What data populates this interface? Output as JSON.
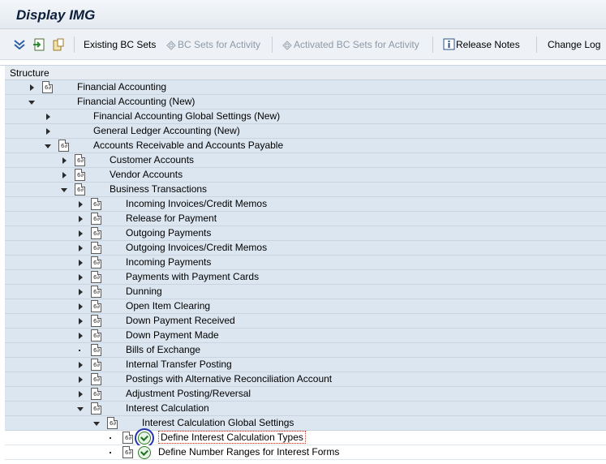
{
  "window": {
    "title": "Display IMG"
  },
  "toolbar": {
    "existing_bc_sets": "Existing BC Sets",
    "bc_sets_for_activity": "BC Sets for Activity",
    "activated_bc_sets": "Activated BC Sets for Activity",
    "release_notes": "Release Notes",
    "change_log": "Change Log"
  },
  "tree": {
    "header": "Structure",
    "rows": [
      {
        "label": "Financial Accounting",
        "expander": "right",
        "doc": true
      },
      {
        "label": "Financial Accounting (New)",
        "expander": "down",
        "doc": false
      },
      {
        "label": "Financial Accounting Global Settings (New)",
        "expander": "right",
        "doc": false
      },
      {
        "label": "General Ledger Accounting (New)",
        "expander": "right",
        "doc": false
      },
      {
        "label": "Accounts Receivable and Accounts Payable",
        "expander": "down",
        "doc": true
      },
      {
        "label": "Customer Accounts",
        "expander": "right",
        "doc": true
      },
      {
        "label": "Vendor Accounts",
        "expander": "right",
        "doc": true
      },
      {
        "label": "Business Transactions",
        "expander": "down",
        "doc": true
      },
      {
        "label": "Incoming Invoices/Credit Memos",
        "expander": "right",
        "doc": true
      },
      {
        "label": "Release for Payment",
        "expander": "right",
        "doc": true
      },
      {
        "label": "Outgoing Payments",
        "expander": "right",
        "doc": true
      },
      {
        "label": "Outgoing Invoices/Credit Memos",
        "expander": "right",
        "doc": true
      },
      {
        "label": "Incoming Payments",
        "expander": "right",
        "doc": true
      },
      {
        "label": "Payments with Payment Cards",
        "expander": "right",
        "doc": true
      },
      {
        "label": "Dunning",
        "expander": "right",
        "doc": true
      },
      {
        "label": "Open Item Clearing",
        "expander": "right",
        "doc": true
      },
      {
        "label": "Down Payment Received",
        "expander": "right",
        "doc": true
      },
      {
        "label": "Down Payment Made",
        "expander": "right",
        "doc": true
      },
      {
        "label": "Bills of Exchange",
        "expander": "dot",
        "doc": true
      },
      {
        "label": "Internal Transfer Posting",
        "expander": "right",
        "doc": true
      },
      {
        "label": "Postings with Alternative Reconciliation Account",
        "expander": "right",
        "doc": true
      },
      {
        "label": "Adjustment Posting/Reversal",
        "expander": "right",
        "doc": true
      },
      {
        "label": "Interest Calculation",
        "expander": "down",
        "doc": true
      },
      {
        "label": "Interest Calculation Global Settings",
        "expander": "down",
        "doc": true
      },
      {
        "label": "Define Interest Calculation Types",
        "expander": "dot",
        "doc": true,
        "exec": true,
        "selected": true
      },
      {
        "label": "Define Number Ranges for Interest Forms",
        "expander": "dot",
        "doc": true,
        "exec": true,
        "selected": true
      }
    ]
  }
}
